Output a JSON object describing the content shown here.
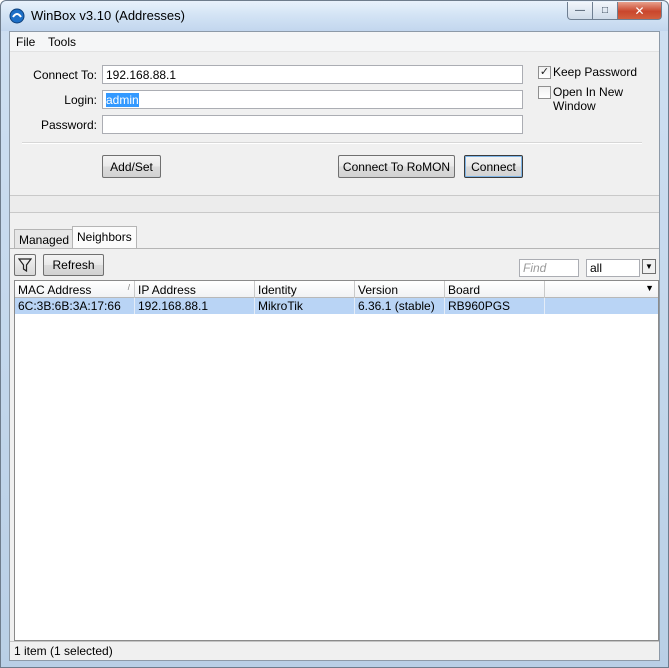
{
  "window": {
    "title": "WinBox v3.10 (Addresses)",
    "controls": {
      "minimize": "—",
      "maximize": "□",
      "close": "✕"
    }
  },
  "menu": {
    "items": [
      "File",
      "Tools"
    ]
  },
  "login_form": {
    "connect_to_label": "Connect To:",
    "connect_to_value": "192.168.88.1",
    "login_label": "Login:",
    "login_value": "admin",
    "password_label": "Password:",
    "password_value": "",
    "keep_password_label": "Keep Password",
    "keep_password_checked": true,
    "open_new_window_label": "Open In New Window",
    "open_new_window_checked": false,
    "add_set_label": "Add/Set",
    "connect_romon_label": "Connect To RoMON",
    "connect_label": "Connect"
  },
  "tabs": [
    "Managed",
    "Neighbors"
  ],
  "active_tab": "Neighbors",
  "toolbar": {
    "refresh_label": "Refresh",
    "find_placeholder": "Find",
    "filter_value": "all"
  },
  "table": {
    "columns": [
      "MAC Address",
      "IP Address",
      "Identity",
      "Version",
      "Board"
    ],
    "rows": [
      [
        "6C:3B:6B:3A:17:66",
        "192.168.88.1",
        "MikroTik",
        "6.36.1 (stable)",
        "RB960PGS"
      ]
    ]
  },
  "status": {
    "text": "1 item (1 selected)"
  },
  "colors": {
    "selection": "#b9d4f5",
    "text_selection": "#3399ff"
  }
}
